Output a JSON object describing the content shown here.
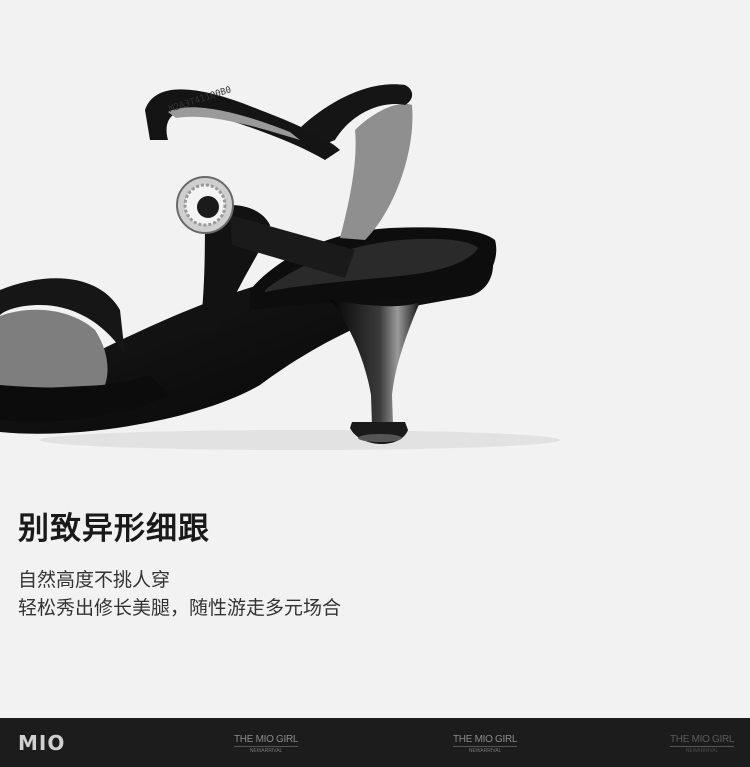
{
  "headline": "别致异形细跟",
  "description": {
    "line1": "自然高度不挑人穿",
    "line2": "轻松秀出修长美腿，随性游走多元场合"
  },
  "shoe": {
    "insole_code": "M2A3T41100B0"
  },
  "footer": {
    "logo": "MIO",
    "tags": [
      {
        "title": "THE MIO GIRL",
        "subtitle": "NEWARRIVAL"
      },
      {
        "title": "THE MIO GIRL",
        "subtitle": "NEWARRIVAL"
      },
      {
        "title": "THE MIO GIRL",
        "subtitle": "NEWARRIVAL"
      }
    ]
  },
  "colors": {
    "background": "#f2f2f2",
    "footer": "#1c1c1c",
    "shoe": "#111111",
    "lining": "#8f8f8f"
  }
}
